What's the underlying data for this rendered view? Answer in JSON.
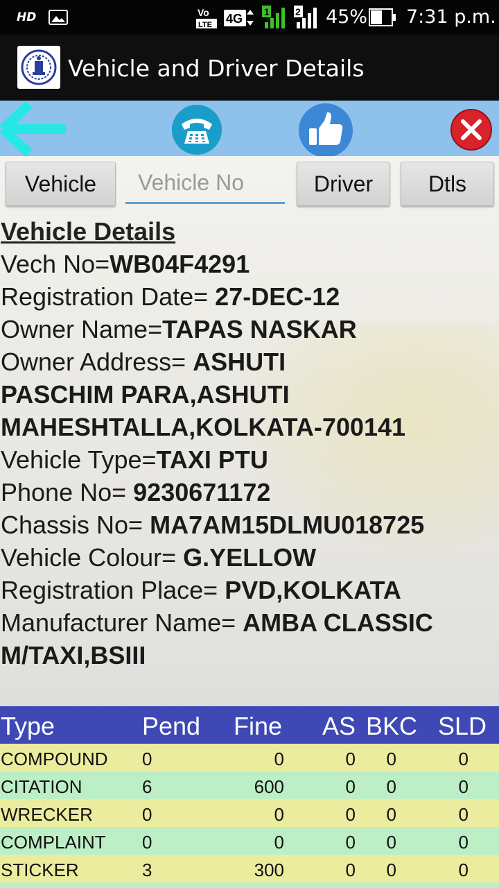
{
  "status_bar": {
    "hd_label": "HD",
    "volte_top": "Vo",
    "volte_bottom": "LTE",
    "network_label": "4G",
    "sim1_label": "1",
    "sim2_label": "2",
    "battery_percent": "45%",
    "time": "7:31 p.m."
  },
  "app_bar": {
    "title": "Vehicle and Driver Details"
  },
  "toolbar": {
    "back_icon": "back-arrow-icon",
    "call_icon": "phone-icon",
    "like_icon": "thumbs-up-icon",
    "close_icon": "close-icon"
  },
  "search": {
    "vehicle_button": "Vehicle",
    "vehicle_no_placeholder": "Vehicle No",
    "vehicle_no_value": "",
    "driver_button": "Driver",
    "dtls_button": "Dtls"
  },
  "details": {
    "heading": "Vehicle Details",
    "vech_no_label": "Vech No=",
    "vech_no": "WB04F4291",
    "reg_date_label": "Registration Date= ",
    "reg_date": "27-DEC-12",
    "owner_name_label": "Owner Name=",
    "owner_name": "TAPAS NASKAR",
    "owner_address_label": "Owner Address= ",
    "owner_address_l1": "ASHUTI",
    "owner_address_l2": "PASCHIM PARA,ASHUTI",
    "owner_address_l3": "MAHESHTALLA,KOLKATA-700141",
    "vehicle_type_label": "Vehicle Type=",
    "vehicle_type": "TAXI PTU",
    "phone_label": "Phone No= ",
    "phone": "9230671172",
    "chassis_label": "Chassis No= ",
    "chassis": "MA7AM15DLMU018725",
    "colour_label": "Vehicle Colour= ",
    "colour": "G.YELLOW",
    "reg_place_label": "Registration Place= ",
    "reg_place": "PVD,KOLKATA",
    "manufacturer_label": "Manufacturer Name= ",
    "manufacturer_l1": "AMBA CLASSIC",
    "manufacturer_l2": "M/TAXI,BSIII"
  },
  "table": {
    "headers": {
      "type": "Type",
      "pend": "Pend",
      "fine": "Fine",
      "as": "AS",
      "bkc": "BKC",
      "sld": "SLD"
    },
    "rows": [
      {
        "type": "COMPOUND",
        "pend": "0",
        "fine": "0",
        "as": "0",
        "bkc": "0",
        "sld": "0"
      },
      {
        "type": "CITATION",
        "pend": "6",
        "fine": "600",
        "as": "0",
        "bkc": "0",
        "sld": "0"
      },
      {
        "type": "WRECKER",
        "pend": "0",
        "fine": "0",
        "as": "0",
        "bkc": "0",
        "sld": "0"
      },
      {
        "type": "COMPLAINT",
        "pend": "0",
        "fine": "0",
        "as": "0",
        "bkc": "0",
        "sld": "0"
      },
      {
        "type": "STICKER",
        "pend": "3",
        "fine": "300",
        "as": "0",
        "bkc": "0",
        "sld": "0"
      }
    ]
  },
  "colors": {
    "status_bar_bg": "#050505",
    "app_bar_bg": "#0f0f0f",
    "toolbar_bg": "#8ec1ec",
    "table_header_bg": "#3e49b5",
    "row_yellow": "#ecec9e",
    "row_green": "#bdefc6",
    "back_arrow": "#27e6e6",
    "call_button": "#1a9dc9",
    "like_button": "#3c88d6",
    "close_button": "#d8232b"
  }
}
